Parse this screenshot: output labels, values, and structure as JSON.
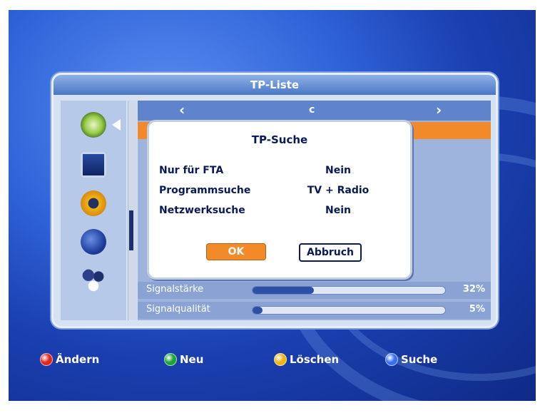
{
  "window": {
    "title": "TP-Liste"
  },
  "satellite_nav": {
    "left_arrow": "‹",
    "current": "c",
    "right_arrow": "›"
  },
  "signal": [
    {
      "label": "Signalstärke",
      "percent_text": "32%",
      "level": 32
    },
    {
      "label": "Signalqualität",
      "percent_text": "5%",
      "level": 5
    }
  ],
  "dialog": {
    "title": "TP-Suche",
    "options": [
      {
        "label": "Nur für FTA",
        "value": "Nein"
      },
      {
        "label": "Programmsuche",
        "value": "TV + Radio"
      },
      {
        "label": "Netzwerksuche",
        "value": "Nein"
      }
    ],
    "ok_label": "OK",
    "cancel_label": "Abbruch"
  },
  "legend": {
    "red_label": "Ändern",
    "green_label": "Neu",
    "yellow_label": "Löschen",
    "blue_label": "Suche"
  },
  "colors": {
    "red": "#e2261e",
    "green": "#1fa236",
    "yellow": "#f0b414",
    "blue": "#3b6df0",
    "accent_orange": "#f28a2a"
  },
  "icons": [
    "satellite-dish-icon",
    "tv-monitor-icon",
    "settings-gear-icon",
    "globe-icon",
    "molecule-icon"
  ]
}
